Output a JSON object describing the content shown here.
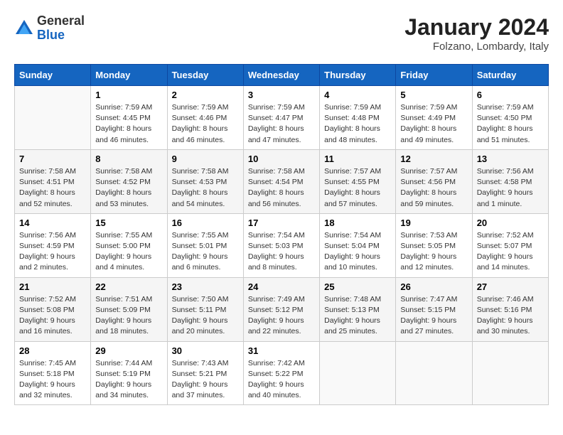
{
  "header": {
    "logo": {
      "general": "General",
      "blue": "Blue"
    },
    "month_year": "January 2024",
    "location": "Folzano, Lombardy, Italy"
  },
  "days_of_week": [
    "Sunday",
    "Monday",
    "Tuesday",
    "Wednesday",
    "Thursday",
    "Friday",
    "Saturday"
  ],
  "weeks": [
    [
      {
        "day": "",
        "info": ""
      },
      {
        "day": "1",
        "info": "Sunrise: 7:59 AM\nSunset: 4:45 PM\nDaylight: 8 hours\nand 46 minutes."
      },
      {
        "day": "2",
        "info": "Sunrise: 7:59 AM\nSunset: 4:46 PM\nDaylight: 8 hours\nand 46 minutes."
      },
      {
        "day": "3",
        "info": "Sunrise: 7:59 AM\nSunset: 4:47 PM\nDaylight: 8 hours\nand 47 minutes."
      },
      {
        "day": "4",
        "info": "Sunrise: 7:59 AM\nSunset: 4:48 PM\nDaylight: 8 hours\nand 48 minutes."
      },
      {
        "day": "5",
        "info": "Sunrise: 7:59 AM\nSunset: 4:49 PM\nDaylight: 8 hours\nand 49 minutes."
      },
      {
        "day": "6",
        "info": "Sunrise: 7:59 AM\nSunset: 4:50 PM\nDaylight: 8 hours\nand 51 minutes."
      }
    ],
    [
      {
        "day": "7",
        "info": "Sunrise: 7:58 AM\nSunset: 4:51 PM\nDaylight: 8 hours\nand 52 minutes."
      },
      {
        "day": "8",
        "info": "Sunrise: 7:58 AM\nSunset: 4:52 PM\nDaylight: 8 hours\nand 53 minutes."
      },
      {
        "day": "9",
        "info": "Sunrise: 7:58 AM\nSunset: 4:53 PM\nDaylight: 8 hours\nand 54 minutes."
      },
      {
        "day": "10",
        "info": "Sunrise: 7:58 AM\nSunset: 4:54 PM\nDaylight: 8 hours\nand 56 minutes."
      },
      {
        "day": "11",
        "info": "Sunrise: 7:57 AM\nSunset: 4:55 PM\nDaylight: 8 hours\nand 57 minutes."
      },
      {
        "day": "12",
        "info": "Sunrise: 7:57 AM\nSunset: 4:56 PM\nDaylight: 8 hours\nand 59 minutes."
      },
      {
        "day": "13",
        "info": "Sunrise: 7:56 AM\nSunset: 4:58 PM\nDaylight: 9 hours\nand 1 minute."
      }
    ],
    [
      {
        "day": "14",
        "info": "Sunrise: 7:56 AM\nSunset: 4:59 PM\nDaylight: 9 hours\nand 2 minutes."
      },
      {
        "day": "15",
        "info": "Sunrise: 7:55 AM\nSunset: 5:00 PM\nDaylight: 9 hours\nand 4 minutes."
      },
      {
        "day": "16",
        "info": "Sunrise: 7:55 AM\nSunset: 5:01 PM\nDaylight: 9 hours\nand 6 minutes."
      },
      {
        "day": "17",
        "info": "Sunrise: 7:54 AM\nSunset: 5:03 PM\nDaylight: 9 hours\nand 8 minutes."
      },
      {
        "day": "18",
        "info": "Sunrise: 7:54 AM\nSunset: 5:04 PM\nDaylight: 9 hours\nand 10 minutes."
      },
      {
        "day": "19",
        "info": "Sunrise: 7:53 AM\nSunset: 5:05 PM\nDaylight: 9 hours\nand 12 minutes."
      },
      {
        "day": "20",
        "info": "Sunrise: 7:52 AM\nSunset: 5:07 PM\nDaylight: 9 hours\nand 14 minutes."
      }
    ],
    [
      {
        "day": "21",
        "info": "Sunrise: 7:52 AM\nSunset: 5:08 PM\nDaylight: 9 hours\nand 16 minutes."
      },
      {
        "day": "22",
        "info": "Sunrise: 7:51 AM\nSunset: 5:09 PM\nDaylight: 9 hours\nand 18 minutes."
      },
      {
        "day": "23",
        "info": "Sunrise: 7:50 AM\nSunset: 5:11 PM\nDaylight: 9 hours\nand 20 minutes."
      },
      {
        "day": "24",
        "info": "Sunrise: 7:49 AM\nSunset: 5:12 PM\nDaylight: 9 hours\nand 22 minutes."
      },
      {
        "day": "25",
        "info": "Sunrise: 7:48 AM\nSunset: 5:13 PM\nDaylight: 9 hours\nand 25 minutes."
      },
      {
        "day": "26",
        "info": "Sunrise: 7:47 AM\nSunset: 5:15 PM\nDaylight: 9 hours\nand 27 minutes."
      },
      {
        "day": "27",
        "info": "Sunrise: 7:46 AM\nSunset: 5:16 PM\nDaylight: 9 hours\nand 30 minutes."
      }
    ],
    [
      {
        "day": "28",
        "info": "Sunrise: 7:45 AM\nSunset: 5:18 PM\nDaylight: 9 hours\nand 32 minutes."
      },
      {
        "day": "29",
        "info": "Sunrise: 7:44 AM\nSunset: 5:19 PM\nDaylight: 9 hours\nand 34 minutes."
      },
      {
        "day": "30",
        "info": "Sunrise: 7:43 AM\nSunset: 5:21 PM\nDaylight: 9 hours\nand 37 minutes."
      },
      {
        "day": "31",
        "info": "Sunrise: 7:42 AM\nSunset: 5:22 PM\nDaylight: 9 hours\nand 40 minutes."
      },
      {
        "day": "",
        "info": ""
      },
      {
        "day": "",
        "info": ""
      },
      {
        "day": "",
        "info": ""
      }
    ]
  ]
}
